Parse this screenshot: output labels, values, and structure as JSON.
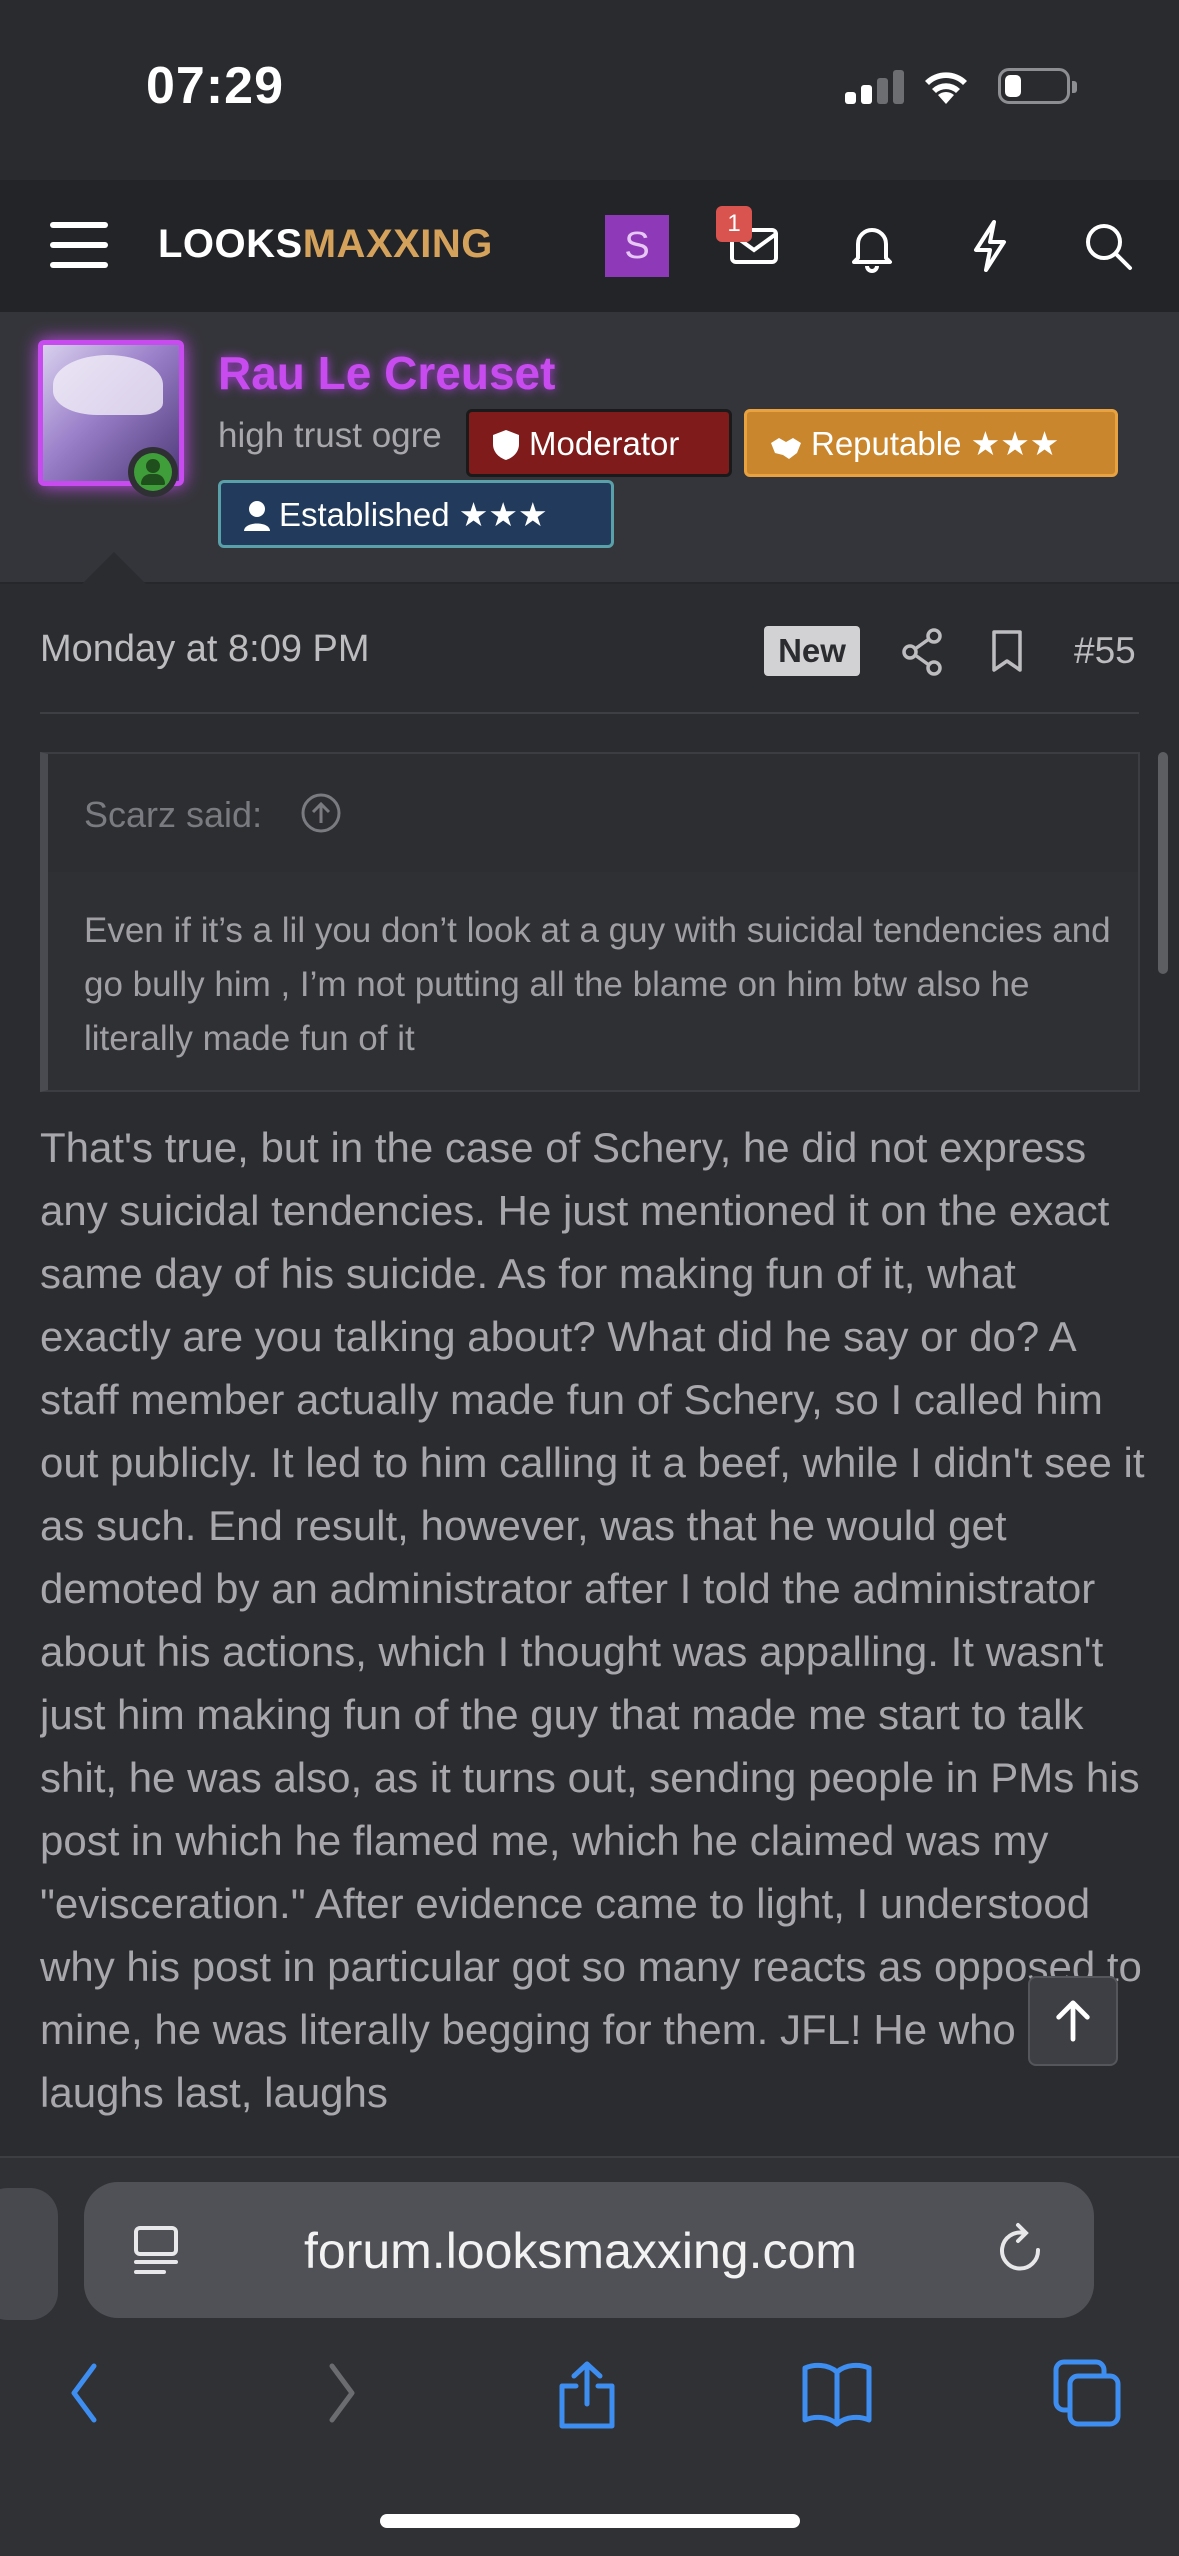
{
  "status_bar": {
    "time": "07:29"
  },
  "nav": {
    "logo_part1": "LOOKS",
    "logo_part2": "MAXXING",
    "user_initial": "S",
    "inbox_badge": "1"
  },
  "author": {
    "name": "Rau Le Creuset",
    "title": "high trust ogre",
    "tags": {
      "moderator": "Moderator",
      "reputable": "Reputable ★★★",
      "established": "Established ★★★"
    }
  },
  "post": {
    "timestamp": "Monday at 8:09 PM",
    "new_label": "New",
    "number": "#55",
    "quote": {
      "attribution": "Scarz said:",
      "text": "Even if it’s a lil you don’t look at a guy with suicidal tendencies and go bully him , I’m not putting all the blame on him btw also he literally made fun of it"
    },
    "body": "That's true, but in the case of Schery, he did not express any suicidal tendencies. He just mentioned it on the exact same day of his suicide. As for making fun of it, what exactly are you talking about? What did he say or do? A staff member actually made fun of Schery, so I called him out publicly. It led to him calling it a beef, while I didn't see it as such. End result, however, was that he would get demoted by an administrator after I told the administrator about his actions, which I thought was appalling. It wasn't just him making fun of the guy that made me start to talk shit, he was also, as it turns out, sending people in PMs his post in which he flamed me, which he claimed was my \"evisceration.\" After evidence came to light, I understood why his post in particular got so many reacts as opposed to mine, he was literally begging for them. JFL! He who laughs last, laughs"
  },
  "browser": {
    "url": "forum.looksmaxxing.com"
  },
  "colors": {
    "accent_gold": "#d4a25b",
    "name_purple": "#c84bf0",
    "moderator_red": "#7f1c1b",
    "reputable_orange": "#c9862c",
    "established_blue": "#223a5c",
    "safari_blue": "#3d8ef0"
  }
}
